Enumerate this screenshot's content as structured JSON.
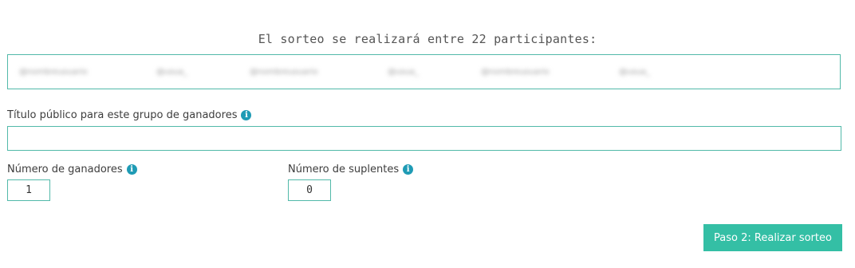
{
  "headline": "El sorteo se realizará entre 22 participantes:",
  "participants": [
    "@nombreusuario",
    "@usua_",
    "@nombreusuario",
    "@usua_",
    "@nombreusuario",
    "@usua_"
  ],
  "title_field": {
    "label": "Título público para este grupo de ganadores",
    "value": "",
    "placeholder": ""
  },
  "winners_field": {
    "label": "Número de ganadores",
    "value": "1"
  },
  "substitutes_field": {
    "label": "Número de suplentes",
    "value": "0"
  },
  "info_icon_glyph": "i",
  "submit_button": {
    "label": "Paso 2: Realizar sorteo"
  },
  "colors": {
    "accent": "#52b9a9",
    "button": "#34bfa5",
    "info_icon": "#1f9bb5"
  }
}
